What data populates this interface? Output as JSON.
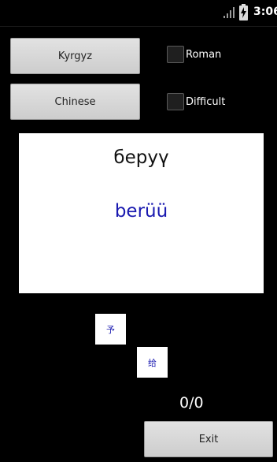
{
  "status_bar": {
    "time": "3:06",
    "icons": [
      "signal-icon",
      "battery-charging-icon"
    ]
  },
  "buttons": {
    "kyrgyz": "Kyrgyz",
    "chinese": "Chinese",
    "exit": "Exit"
  },
  "options": {
    "roman": {
      "label": "Roman",
      "checked": false
    },
    "difficult": {
      "label": "Difficult",
      "checked": false
    }
  },
  "card": {
    "word_cyrillic": "беруү",
    "word_roman": "berüü"
  },
  "choices": [
    "予",
    "给"
  ],
  "score": "0/0",
  "colors": {
    "background": "#000000",
    "card": "#ffffff",
    "accent_blue": "#1a1ab0",
    "button": "#d6d6d6"
  }
}
